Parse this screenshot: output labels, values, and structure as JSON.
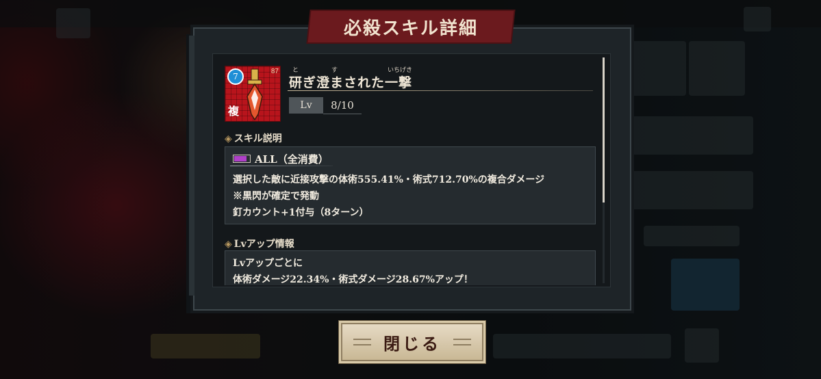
{
  "dialog": {
    "title": "必殺スキル詳細",
    "skill": {
      "name": "研ぎ澄まされた一撃",
      "ruby_to": "と",
      "ruby_su": "す",
      "ruby_ichigeki": "いちげき",
      "icon_badge": "7",
      "icon_corner": "87",
      "icon_type": "複",
      "level_label": "Lv",
      "level_value": "8/10"
    },
    "description_section": {
      "heading": "スキル説明",
      "cost_label": "ALL（全消費）",
      "cost_gauge_fraction": 0.8,
      "lines": [
        "選択した敵に近接攻撃の体術555.41%・術式712.70%の複合ダメージ",
        "※黒閃が確定で発動",
        "釘カウント+1付与（8ターン）"
      ]
    },
    "levelup_section": {
      "heading": "Lvアップ情報",
      "lines": [
        "Lvアップごとに",
        "体術ダメージ22.34%・術式ダメージ28.67%アップ！"
      ]
    },
    "close_label": "閉じる"
  },
  "colors": {
    "ribbon": "#6b1a1e",
    "panel": "#14181b",
    "text": "#f2ece0",
    "gauge": "#b040c8",
    "icon_bg": "#b8141c"
  }
}
